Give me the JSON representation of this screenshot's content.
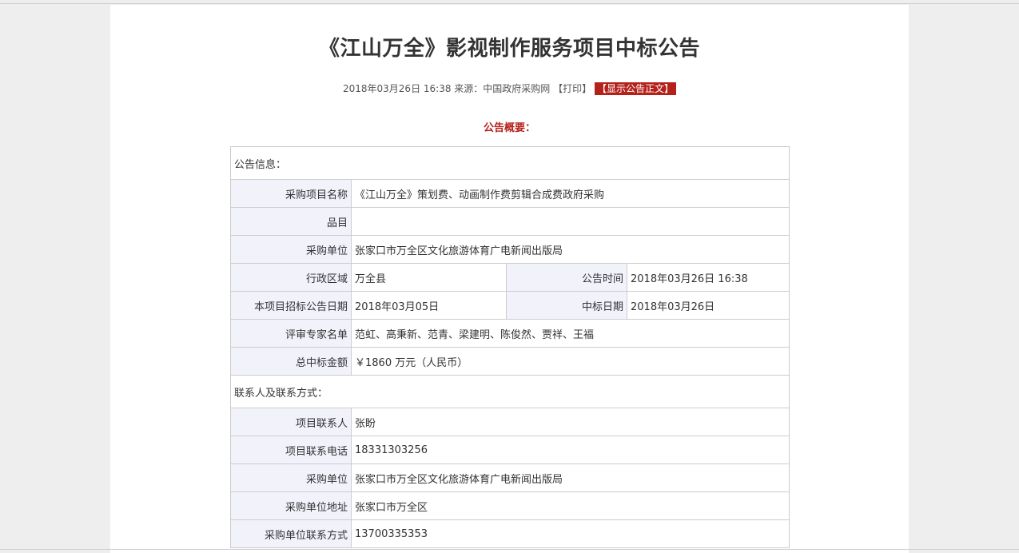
{
  "title": "《江山万全》影视制作服务项目中标公告",
  "meta": {
    "datetime": "2018年03月26日 16:38",
    "source": "来源：中国政府采购网",
    "print": "【打印】",
    "show_text": "【显示公告正文】"
  },
  "overview": "公告概要：",
  "section1": "公告信息：",
  "rows": {
    "project_name": {
      "label": "采购项目名称",
      "value": "《江山万全》策划费、动画制作费剪辑合成费政府采购"
    },
    "category": {
      "label": "品目",
      "value": ""
    },
    "buyer": {
      "label": "采购单位",
      "value": "张家口市万全区文化旅游体育广电新闻出版局"
    },
    "region": {
      "label": "行政区域",
      "value": "万全县"
    },
    "pub_time": {
      "label": "公告时间",
      "value": "2018年03月26日 16:38"
    },
    "bid_date": {
      "label": "本项目招标公告日期",
      "value": "2018年03月05日"
    },
    "win_date": {
      "label": "中标日期",
      "value": "2018年03月26日"
    },
    "experts": {
      "label": "评审专家名单",
      "value": "范虹、高秉新、范青、梁建明、陈俊然、贾祥、王福"
    },
    "amount": {
      "label": "总中标金额",
      "value": "￥1860 万元（人民币）"
    }
  },
  "section2": "联系人及联系方式：",
  "contacts": {
    "contact_person": {
      "label": "项目联系人",
      "value": "张盼"
    },
    "contact_phone": {
      "label": "项目联系电话",
      "value": "18331303256"
    },
    "buyer": {
      "label": "采购单位",
      "value": "张家口市万全区文化旅游体育广电新闻出版局"
    },
    "buyer_address": {
      "label": "采购单位地址",
      "value": "张家口市万全区"
    },
    "buyer_contact": {
      "label": "采购单位联系方式",
      "value": "13700335353"
    }
  }
}
